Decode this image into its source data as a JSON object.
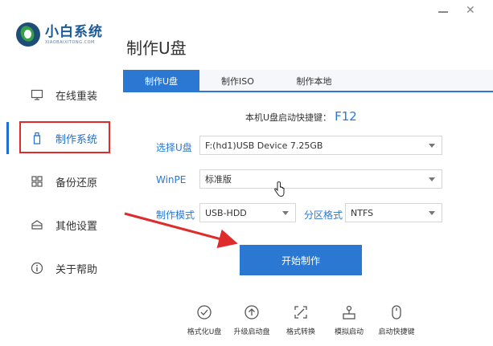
{
  "app": {
    "logo_title": "小白系统",
    "logo_subtitle": "XIAOBAIXITONG.COM",
    "page_title": "制作U盘"
  },
  "sidebar": {
    "items": [
      {
        "label": "在线重装",
        "icon": "monitor-icon"
      },
      {
        "label": "制作系统",
        "icon": "usb-drive-icon",
        "active": true
      },
      {
        "label": "备份还原",
        "icon": "grid-icon"
      },
      {
        "label": "其他设置",
        "icon": "box-icon"
      },
      {
        "label": "关于帮助",
        "icon": "info-icon"
      }
    ]
  },
  "tabs": [
    {
      "label": "制作U盘",
      "active": true
    },
    {
      "label": "制作ISO"
    },
    {
      "label": "制作本地"
    }
  ],
  "hotkey": {
    "text": "本机U盘启动快捷键：",
    "key": "F12"
  },
  "form": {
    "usb_label": "选择U盘",
    "usb_value": "F:(hd1)USB Device 7.25GB",
    "winpe_label": "WinPE",
    "winpe_value": "标准版",
    "mode_label": "制作模式",
    "mode_value": "USB-HDD",
    "partition_label": "分区格式",
    "partition_value": "NTFS"
  },
  "start_button": "开始制作",
  "tools": [
    {
      "label": "格式化U盘",
      "icon": "check-circle-icon"
    },
    {
      "label": "升级启动盘",
      "icon": "arrow-up-circle-icon"
    },
    {
      "label": "格式转换",
      "icon": "convert-icon"
    },
    {
      "label": "模拟启动",
      "icon": "joystick-icon"
    },
    {
      "label": "启动快捷键",
      "icon": "mouse-icon"
    }
  ],
  "colors": {
    "accent": "#2a78d2",
    "highlight": "#e02b2b"
  }
}
